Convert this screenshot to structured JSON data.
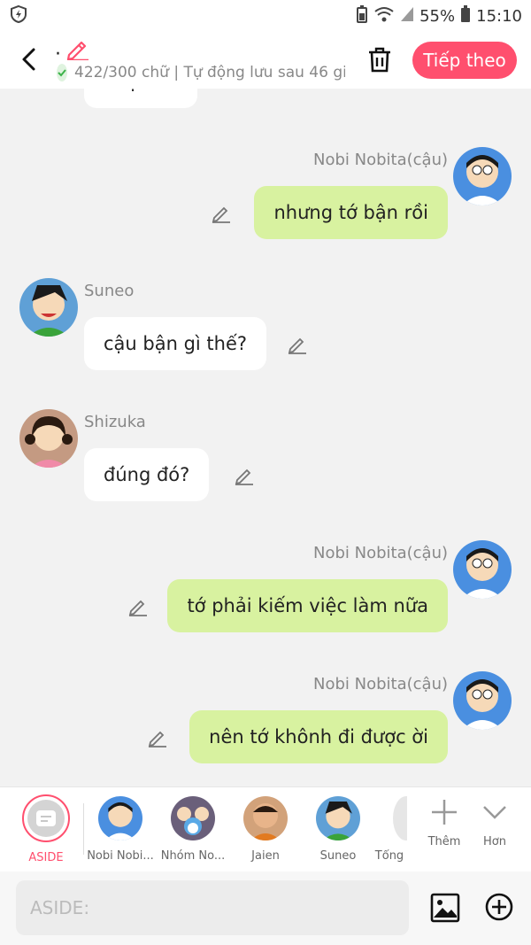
{
  "status_bar": {
    "battery": "55%",
    "time": "15:10"
  },
  "header": {
    "title_dot": "·",
    "autosave_status": "422/300 chữ | Tự động lưu sau 46 giây",
    "next_label": "Tiếp theo"
  },
  "messages": [
    {
      "sender": "",
      "side": "left",
      "text": "được đó"
    },
    {
      "sender": "Nobi Nobita(cậu)",
      "side": "right",
      "text": "nhưng tớ bận rồi"
    },
    {
      "sender": "Suneo",
      "side": "left",
      "text": "cậu bận gì thế?"
    },
    {
      "sender": "Shizuka",
      "side": "left",
      "text": "đúng đó?"
    },
    {
      "sender": "Nobi Nobita(cậu)",
      "side": "right",
      "text": "tớ phải kiếm việc làm nữa"
    },
    {
      "sender": "Nobi Nobita(cậu)",
      "side": "right",
      "text": "nên tớ khônh đi được ời"
    }
  ],
  "characters": [
    {
      "label": "ASIDE",
      "selected": true
    },
    {
      "label": "Nobi Nobi..."
    },
    {
      "label": "Nhóm No..."
    },
    {
      "label": "Jaien"
    },
    {
      "label": "Suneo"
    },
    {
      "label": "Tổng"
    }
  ],
  "actions": {
    "add_label": "Thêm",
    "more_label": "Hơn"
  },
  "composer": {
    "placeholder": "ASIDE:"
  },
  "colors": {
    "accent": "#ff4f6e",
    "user_bubble": "#d8f2a0",
    "other_bubble": "#ffffff",
    "background": "#f2f2f2"
  }
}
